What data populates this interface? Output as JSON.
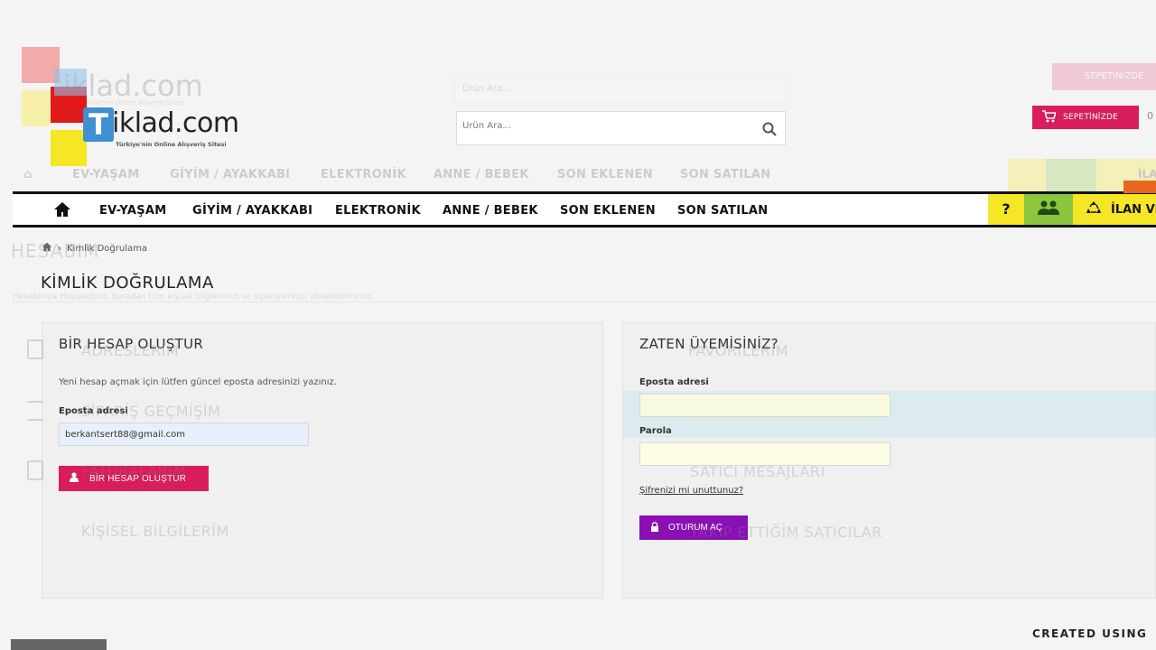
{
  "logo": {
    "initial": "T",
    "text": "iklad.com",
    "tagline": "Türkiye'nin Online Alışveriş Sitesi",
    "ghost_text": "iklad.com",
    "ghost_tagline": "Türkiye'nin Online Alışveriş Sitesi"
  },
  "search": {
    "placeholder": "Ürün Ara...",
    "ghost_placeholder": "Ürün Ara..."
  },
  "cart": {
    "label": "SEPETİNİZDE",
    "ghost_label": "SEPETİNİZDE",
    "after": "0"
  },
  "nav": {
    "items": [
      "EV-YAŞAM",
      "GİYİM / AYAKKABI",
      "ELEKTRONİK",
      "ANNE / BEBEK",
      "SON EKLENEN",
      "SON SATILAN"
    ],
    "help_label": "?",
    "ilan_label": "İLAN VER",
    "ghost_ilan": "İLA"
  },
  "breadcrumb": {
    "current": "Kimlik Doğrulama"
  },
  "page": {
    "title": "KİMLİK DOĞRULAMA",
    "ghost_title": "HESABIM",
    "ghost_subtitle": "Hesabınıza Hoşgeldiniz. Buradan tüm kişisel bilgilerinizi ve siparişlerinizi yönetebilirsiniz."
  },
  "ghost_sidebar": {
    "items": [
      "ADRESLERİM",
      "SİPARİŞ GEÇMİŞİM",
      "FATURALARIM",
      "KİŞİSEL BİLGİLERİM",
      "FAVORİLERİM",
      "SATICI MESAJLARI",
      "TAKİP ETTİĞİM SATICILAR"
    ]
  },
  "create_account": {
    "title": "BİR HESAP OLUŞTUR",
    "description": "Yeni hesap açmak için lütfen güncel eposta adresinizi yazınız.",
    "email_label": "Eposta adresi",
    "email_value": "berkantsert88@gmail.com",
    "button_label": "BİR HESAP OLUŞTUR"
  },
  "login": {
    "title": "ZATEN ÜYEMİSİNİZ?",
    "email_label": "Eposta adresi",
    "email_value": "",
    "password_label": "Parola",
    "password_value": "",
    "forgot_label": "Şifrenizi mi unuttunuz?",
    "button_label": "OTURUM AÇ"
  },
  "footer": {
    "created_using": "CREATED USING"
  },
  "colors": {
    "brand_pink": "#d81c5c",
    "login_purple": "#8a0fb4",
    "nav_yellow": "#f5e626",
    "nav_green": "#8cc63f",
    "logo_blue": "#3f8fd1"
  },
  "icons": [
    "home-icon",
    "cart-icon",
    "search-icon",
    "users-icon",
    "recycle-icon",
    "user-icon",
    "lock-icon"
  ]
}
